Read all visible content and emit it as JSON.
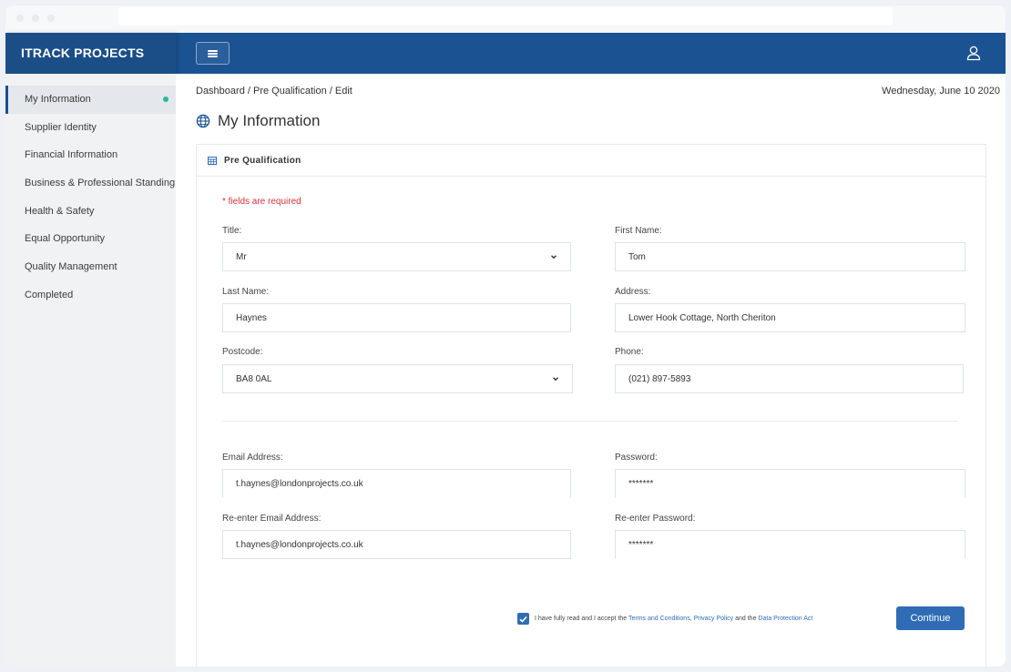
{
  "app": {
    "brand": "ITRACK PROJECTS"
  },
  "icons": {
    "menu": "hamburger-icon",
    "user": "user-icon",
    "globe": "globe-icon",
    "table": "table-icon",
    "chevron": "chevron-down-icon",
    "check": "check-icon"
  },
  "colors": {
    "topbar": "#1b5291",
    "brand": "#1b4e87",
    "accent": "#2f6cb5",
    "active_dot": "#2cb59a",
    "required": "#d9303a"
  },
  "sidebar": {
    "items": [
      {
        "label": "My Information",
        "active": true
      },
      {
        "label": "Supplier Identity"
      },
      {
        "label": "Financial Information"
      },
      {
        "label": "Business & Professional Standing"
      },
      {
        "label": "Health & Safety"
      },
      {
        "label": "Equal Opportunity"
      },
      {
        "label": "Quality Management"
      },
      {
        "label": "Completed"
      }
    ]
  },
  "breadcrumb": {
    "dashboard": "Dashboard",
    "rest": " / Pre Qualification / Edit"
  },
  "date": "Wednesday, June 10 2020",
  "page": {
    "title": "My Information"
  },
  "card": {
    "title": "Pre Qualification"
  },
  "form": {
    "required_note": "* fields are required",
    "title": {
      "label": "Title:",
      "value": "Mr"
    },
    "first_name": {
      "label": "First Name:",
      "value": "Tom"
    },
    "last_name": {
      "label": "Last Name:",
      "value": "Haynes"
    },
    "address": {
      "label": "Address:",
      "value": "Lower Hook Cottage, North Cheriton"
    },
    "postcode": {
      "label": "Postcode:",
      "value": "BA8 0AL"
    },
    "phone": {
      "label": "Phone:",
      "value": "(021) 897-5893"
    },
    "email": {
      "label": "Email Address:",
      "value": "t.haynes@londonprojects.co.uk"
    },
    "password": {
      "label": "Password:",
      "value": "*******"
    },
    "email_confirm": {
      "label": "Re-enter Email Address:",
      "value": "t.haynes@londonprojects.co.uk"
    },
    "password_confirm": {
      "label": "Re-enter Password:",
      "value": "*******"
    }
  },
  "agreement": {
    "checked": true,
    "prefix": "I have fully read and I accept the ",
    "terms": "Terms and Conditions",
    "sep": ", ",
    "privacy": "Privacy Policy",
    "and": " and the ",
    "data_protection": "Data Protection Act"
  },
  "actions": {
    "continue": "Continue"
  }
}
